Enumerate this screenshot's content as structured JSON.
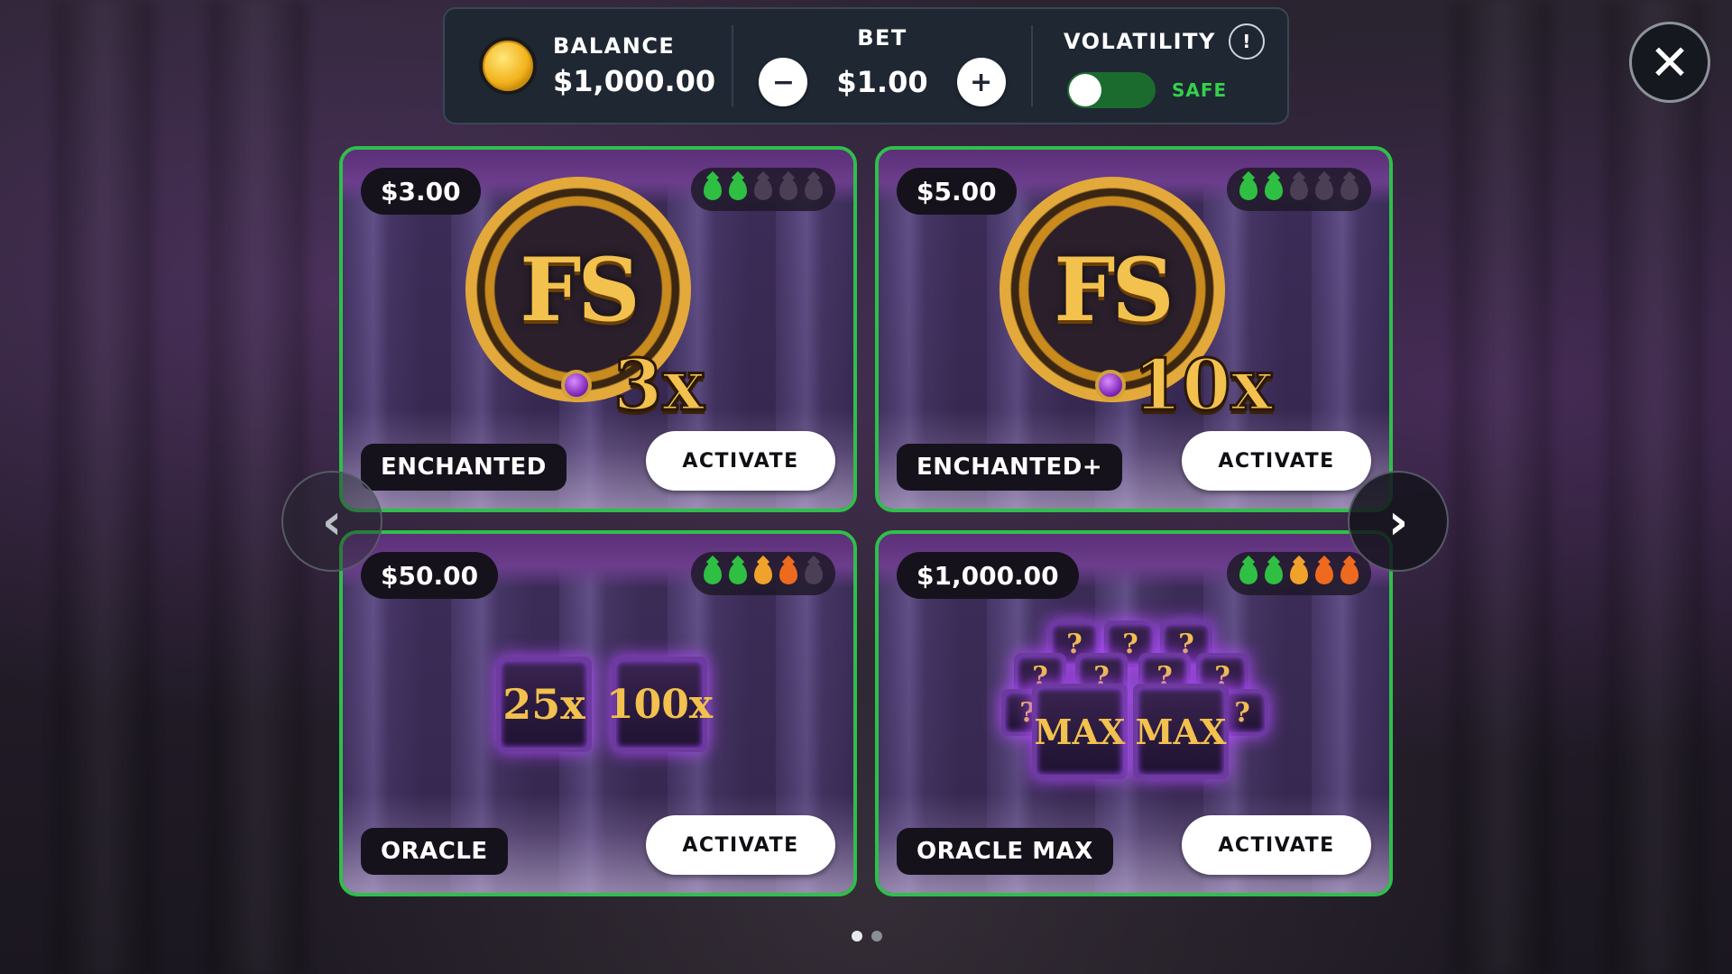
{
  "header": {
    "balance_label": "BALANCE",
    "balance_value": "$1,000.00",
    "bet_label": "BET",
    "bet_value": "$1.00",
    "bet_minus": "−",
    "bet_plus": "+",
    "volatility_label": "VOLATILITY",
    "volatility_info": "!",
    "volatility_mode": "SAFE",
    "volatility_toggle_on": true
  },
  "close_label": "✕",
  "nav": {
    "prev": "‹",
    "next": "›"
  },
  "cards": [
    {
      "price": "$3.00",
      "name": "ENCHANTED",
      "button": "ACTIVATE",
      "art_text": "FS",
      "multiplier": "3x",
      "volatility_drops": [
        "green",
        "green",
        "off",
        "off",
        "off"
      ]
    },
    {
      "price": "$5.00",
      "name": "ENCHANTED+",
      "button": "ACTIVATE",
      "art_text": "FS",
      "multiplier": "10x",
      "volatility_drops": [
        "green",
        "green",
        "off",
        "off",
        "off"
      ]
    },
    {
      "price": "$50.00",
      "name": "ORACLE",
      "button": "ACTIVATE",
      "chests": [
        "25x",
        "100x"
      ],
      "volatility_drops": [
        "green",
        "green",
        "yellow",
        "orange",
        "off"
      ]
    },
    {
      "price": "$1,000.00",
      "name": "ORACLE MAX",
      "button": "ACTIVATE",
      "chests": [
        "MAX",
        "MAX"
      ],
      "mystery": "?",
      "volatility_drops": [
        "green",
        "green",
        "yellow",
        "orange",
        "orange"
      ]
    }
  ],
  "pagination": {
    "pages": 2,
    "current": 1
  },
  "colors": {
    "accent_green": "#2fbf4a",
    "panel": "#1f2733",
    "gold": "#f2c14e"
  }
}
